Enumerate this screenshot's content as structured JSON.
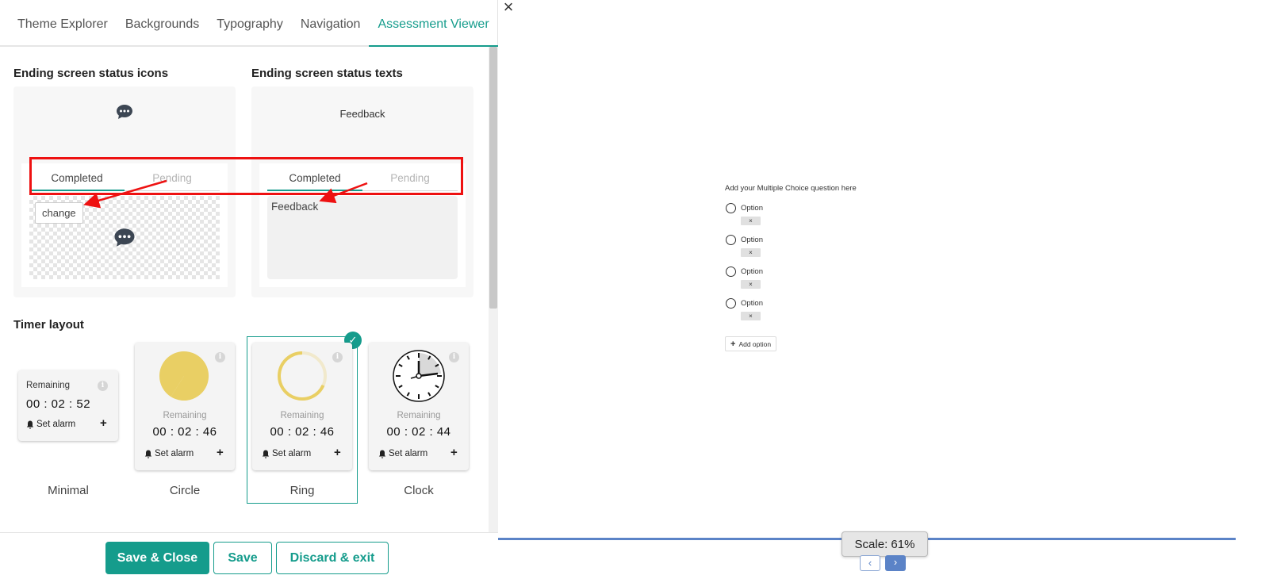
{
  "tabs": [
    "Theme Explorer",
    "Backgrounds",
    "Typography",
    "Navigation",
    "Assessment Viewer"
  ],
  "active_tab": "Assessment Viewer",
  "status_icons": {
    "title": "Ending screen status icons",
    "subtabs": [
      "Completed",
      "Pending"
    ],
    "change_label": "change"
  },
  "status_texts": {
    "title": "Ending screen status texts",
    "preview_text": "Feedback",
    "subtabs": [
      "Completed",
      "Pending"
    ],
    "value": "Feedback"
  },
  "timer": {
    "title": "Timer layout",
    "cards": [
      {
        "name": "Minimal",
        "label": "Remaining",
        "time": "00 : 02 : 52",
        "alarm": "Set alarm",
        "plus": "+",
        "info": "i"
      },
      {
        "name": "Circle",
        "label": "Remaining",
        "time": "00 : 02 : 46",
        "alarm": "Set alarm",
        "plus": "+",
        "info": "i"
      },
      {
        "name": "Ring",
        "label": "Remaining",
        "time": "00 : 02 : 46",
        "alarm": "Set alarm",
        "plus": "+",
        "info": "i"
      },
      {
        "name": "Clock",
        "label": "Remaining",
        "time": "00 : 02 : 44",
        "alarm": "Set alarm",
        "plus": "+",
        "info": "i"
      }
    ],
    "selected": "Ring"
  },
  "footer": {
    "save_close": "Save & Close",
    "save": "Save",
    "discard": "Discard & exit"
  },
  "preview": {
    "close": "×",
    "question": "Add your Multiple Choice question here",
    "options": [
      "Option",
      "Option",
      "Option",
      "Option"
    ],
    "remove": "×",
    "add_option": "Add option",
    "add_icon": "+",
    "scale": "Scale: 61%",
    "prev": "‹",
    "next": "›"
  },
  "colors": {
    "accent": "#159c8c",
    "annotation": "#ee1111",
    "progress": "#5b83c7",
    "timer_fill": "#e9cf64"
  },
  "icons": [
    "chat-bubble-icon",
    "bell-icon",
    "info-icon",
    "check-icon",
    "close-icon",
    "plus-icon",
    "chevron-left-icon",
    "chevron-right-icon"
  ]
}
